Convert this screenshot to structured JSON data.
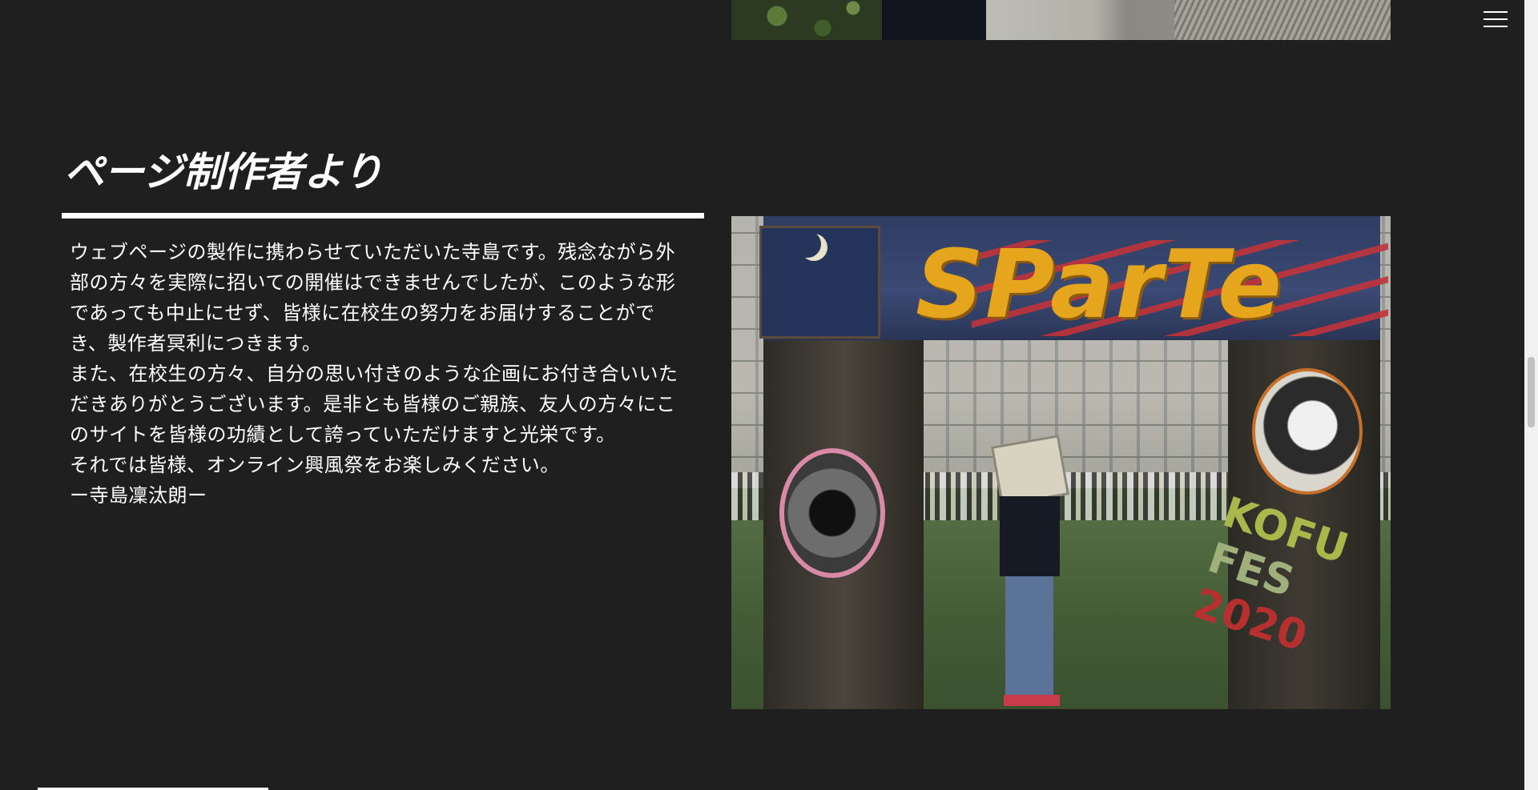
{
  "section": {
    "title": "ページ制作者より",
    "paragraphs": [
      "ウェブページの製作に携わらせていただいた寺島です。残念ながら外部の方々を実際に招いての開催はできませんでしたが、このような形であっても中止にせず、皆様に在校生の努力をお届けすることができ、製作者冥利につきます。",
      "また、在校生の方々、自分の思い付きのような企画にお付き合いいただきありがとうございます。是非とも皆様のご親族、友人の方々にこのサイトを皆様の功績として誇っていただけますと光栄です。",
      "それでは皆様、オンライン興風祭をお楽しみください。",
      "ー寺島凜汰朗ー"
    ]
  },
  "photo": {
    "sign_text": "SParTe",
    "banner_lines": [
      "KOFU",
      "FES",
      "2020"
    ]
  },
  "menu": {
    "icon": "hamburger-menu-icon"
  },
  "colors": {
    "background": "#1f1f1f",
    "text": "#ffffff",
    "accent": "#e5a51d"
  }
}
